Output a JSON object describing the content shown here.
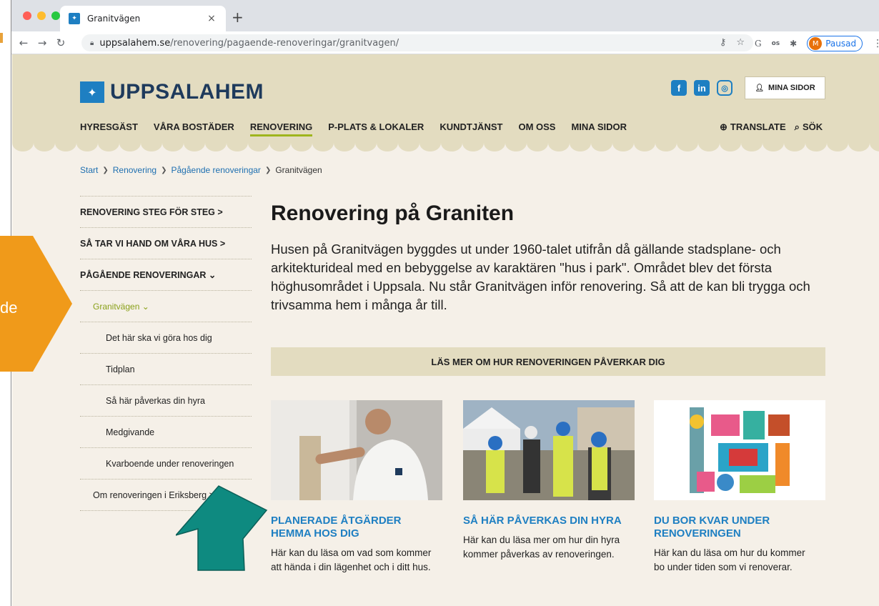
{
  "browser": {
    "tab_title": "Granitvägen",
    "tab_close": "×",
    "new_tab": "+",
    "url_host": "uppsalahem.se",
    "url_path": "/renovering/pagaende-renoveringar/granitvagen/",
    "profile_initial": "M",
    "profile_status": "Pausad",
    "colors": {
      "close": "#ff5f57",
      "minimize": "#febc2e",
      "maximize": "#28c840"
    }
  },
  "site": {
    "logo_text": "UPPSALAHEM",
    "mina_sidor_button": "MINA SIDOR",
    "nav": [
      "HYRESGÄST",
      "VÅRA BOSTÄDER",
      "RENOVERING",
      "P-PLATS & LOKALER",
      "KUNDTJÄNST",
      "OM OSS",
      "MINA SIDOR"
    ],
    "active_nav": "RENOVERING",
    "translate": "TRANSLATE",
    "search": "SÖK",
    "brand_color": "#1e7fc2",
    "accent_color": "#9fb51d",
    "header_color": "#e3dcc0"
  },
  "breadcrumb": [
    "Start",
    "Renovering",
    "Pågående renoveringar",
    "Granitvägen"
  ],
  "sidemenu": {
    "items": [
      "RENOVERING STEG FÖR STEG >",
      "SÅ TAR VI HAND OM VÅRA HUS >",
      "PÅGÅENDE RENOVERINGAR ⌄",
      "Granitvägen ⌄",
      "Det här ska vi göra hos dig",
      "Tidplan",
      "Så här påverkas din hyra",
      "Medgivande",
      "Kvarboende under renoveringen",
      "Om renoveringen i Eriksberg >"
    ]
  },
  "main": {
    "title": "Renovering på Graniten",
    "intro": "Husen på Granitvägen byggdes ut under 1960-talet utifrån då gällande stadsplane- och arkitekturideal med en bebyggelse av karaktären \"hus i park\". Området blev det första höghusområdet i Uppsala. Nu står Granitvägen inför renovering. Så att de kan bli trygga och trivsamma hem i många år till.",
    "banner": "LÄS MER OM HUR RENOVERINGEN PÅVERKAR DIG",
    "cards": [
      {
        "title": "PLANERADE ÅTGÄRDER HEMMA HOS DIG",
        "desc": "Här kan du läsa om vad som kommer att hända i din lägenhet och i ditt hus."
      },
      {
        "title": "SÅ HÄR PÅVERKAS DIN HYRA",
        "desc": "Här kan du läsa mer om hur din hyra kommer påverkas av renoveringen."
      },
      {
        "title": "DU BOR KVAR UNDER RENOVERINGEN",
        "desc": "Här kan du läsa om hur du kommer bo under tiden som vi renoverar."
      }
    ]
  },
  "overlay": {
    "pentagon_text": "de",
    "pentagon_color": "#f09a1a",
    "arrow_color": "#0e8a80"
  }
}
